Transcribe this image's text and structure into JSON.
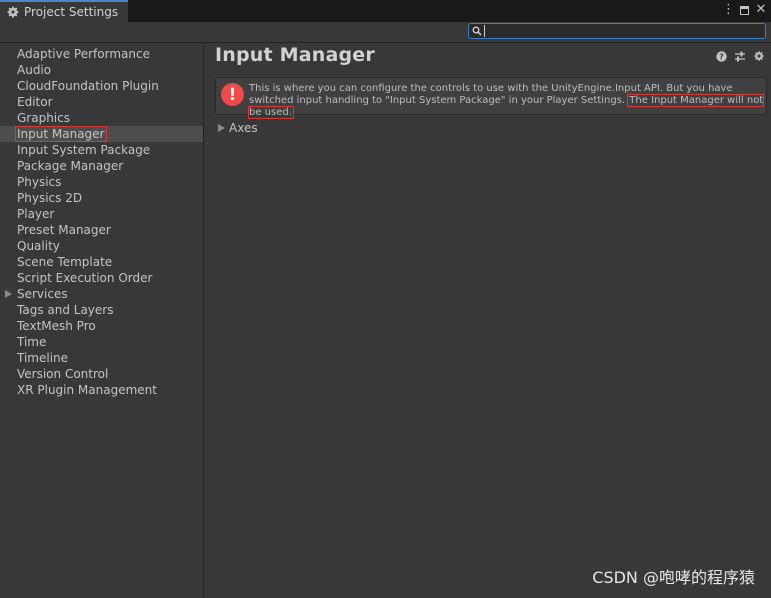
{
  "window": {
    "tab_title": "Project Settings",
    "controls": {
      "menu_icon": "kebab-menu-icon",
      "max_icon": "maximize-icon",
      "close_icon": "close-icon"
    }
  },
  "search": {
    "value": "",
    "placeholder": "",
    "icon": "search-icon"
  },
  "sidebar": {
    "items": [
      {
        "label": "Adaptive Performance"
      },
      {
        "label": "Audio"
      },
      {
        "label": "CloudFoundation Plugin"
      },
      {
        "label": "Editor"
      },
      {
        "label": "Graphics"
      },
      {
        "label": "Input Manager",
        "selected": true
      },
      {
        "label": "Input System Package"
      },
      {
        "label": "Package Manager"
      },
      {
        "label": "Physics"
      },
      {
        "label": "Physics 2D"
      },
      {
        "label": "Player"
      },
      {
        "label": "Preset Manager"
      },
      {
        "label": "Quality"
      },
      {
        "label": "Scene Template"
      },
      {
        "label": "Script Execution Order"
      },
      {
        "label": "Services",
        "expandable": true
      },
      {
        "label": "Tags and Layers"
      },
      {
        "label": "TextMesh Pro"
      },
      {
        "label": "Time"
      },
      {
        "label": "Timeline"
      },
      {
        "label": "Version Control"
      },
      {
        "label": "XR Plugin Management"
      }
    ]
  },
  "main": {
    "title": "Input Manager",
    "header_icons": [
      "help-icon",
      "preset-icon",
      "settings-gear-icon"
    ],
    "alert": {
      "text": "This is where you can configure the controls to use with the UnityEngine.Input API. But you have switched input handling to \"Input System Package\" in your Player Settings. ",
      "highlight": "The Input Manager will not be used."
    },
    "foldout": {
      "label": "Axes"
    }
  },
  "watermark": "CSDN @咆哮的程序猿",
  "colors": {
    "background": "#383838",
    "selection": "#4d4d4d",
    "error_red": "#f04a4a",
    "accent": "#4a88c9"
  }
}
